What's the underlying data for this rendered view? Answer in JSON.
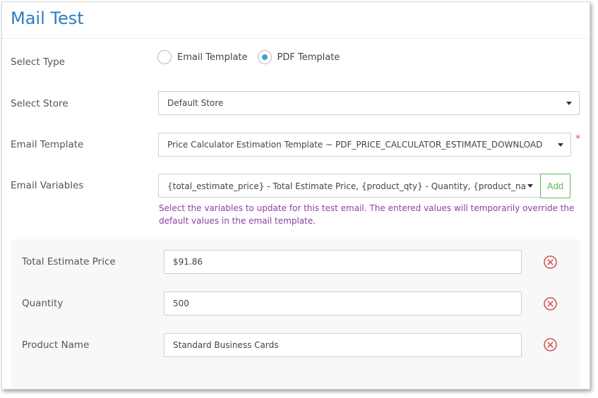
{
  "page": {
    "title": "Mail Test"
  },
  "form": {
    "select_type": {
      "label": "Select Type",
      "options": [
        {
          "label": "Email Template",
          "checked": false
        },
        {
          "label": "PDF Template",
          "checked": true
        }
      ]
    },
    "select_store": {
      "label": "Select Store",
      "value": "Default Store"
    },
    "email_template": {
      "label": "Email Template",
      "value": "Price Calculator Estimation Template ~ PDF_PRICE_CALCULATOR_ESTIMATE_DOWNLOAD",
      "required_marker": "*"
    },
    "email_variables": {
      "label": "Email Variables",
      "value": "{total_estimate_price} - Total Estimate Price, {product_qty} - Quantity, {product_name} - Product Name",
      "add_label": "Add",
      "hint": "Select the variables to update for this test email. The entered values will temporarily override the default values in the email template."
    },
    "variables": [
      {
        "label": "Total Estimate Price",
        "value": "$91.86"
      },
      {
        "label": "Quantity",
        "value": "500"
      },
      {
        "label": "Product Name",
        "value": "Standard Business Cards"
      }
    ]
  },
  "colors": {
    "title": "#2e7dc1",
    "radio_checked": "#3aa3d6",
    "add_button": "#5cb85c",
    "hint": "#8a3fa6",
    "remove_icon": "#d9534f",
    "required": "#d9534f"
  },
  "icons": {
    "remove": "remove-circle-icon",
    "dropdown": "caret-down-icon"
  }
}
